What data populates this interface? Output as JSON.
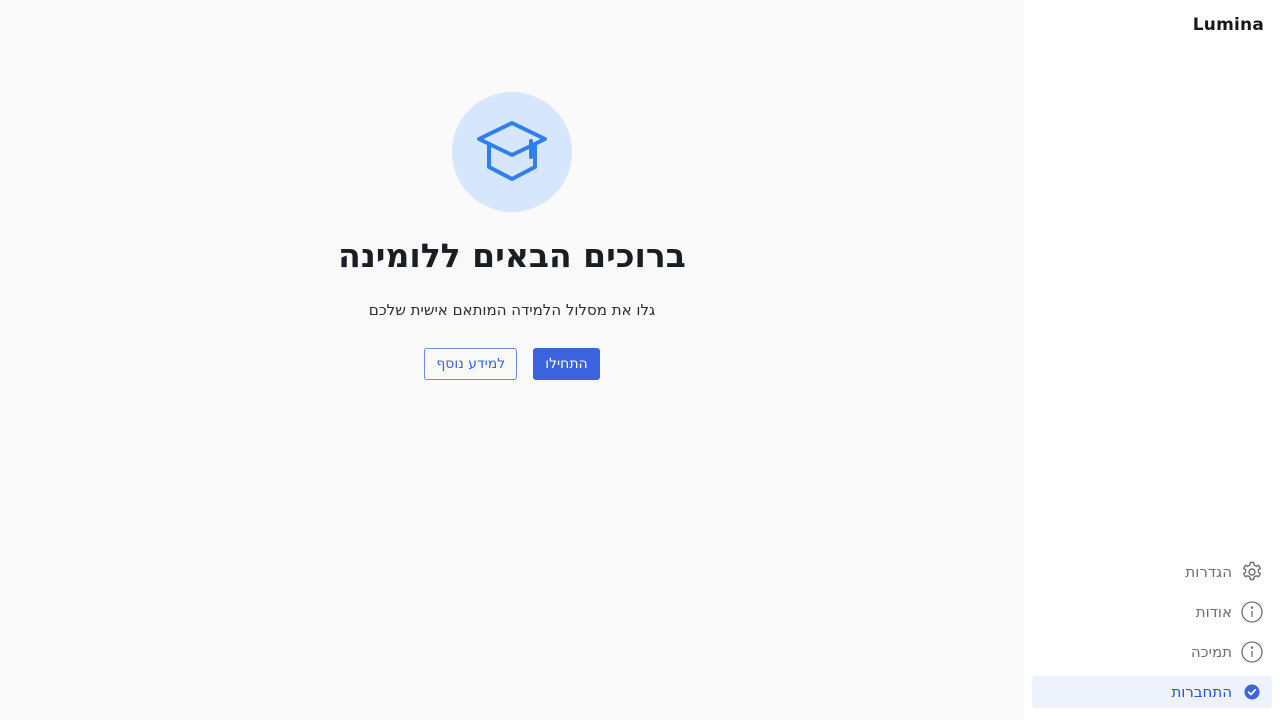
{
  "sidebar": {
    "brand": "Lumina",
    "items": [
      {
        "label": "הגדרות",
        "icon": "gear-icon"
      },
      {
        "label": "אודות",
        "icon": "info-icon"
      },
      {
        "label": "תמיכה",
        "icon": "info-icon"
      },
      {
        "label": "התחברות",
        "icon": "check-circle-icon",
        "active": true
      }
    ]
  },
  "main": {
    "hero_icon": "graduation-cap-icon",
    "title": "ברוכים הבאים ללומינה",
    "subtitle": "גלו את מסלול הלמידה המותאם אישית שלכם",
    "primary_button": "התחילו",
    "secondary_button": "למידע נוסף"
  },
  "colors": {
    "accent": "#3c63de",
    "hero_bg": "#d6e6fd",
    "hero_icon": "#2f80ed",
    "active_bg": "#eef2fd"
  }
}
